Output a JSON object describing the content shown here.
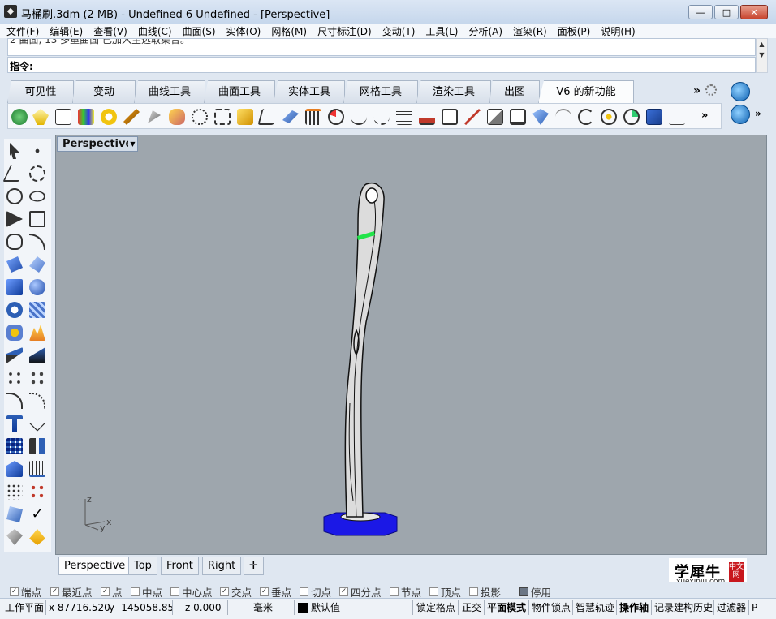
{
  "window": {
    "title": "马桶刷.3dm (2 MB) - Undefined 6 Undefined - [Perspective]",
    "min_label": "—",
    "max_label": "□",
    "close_label": "✕"
  },
  "menu": [
    "文件(F)",
    "编辑(E)",
    "查看(V)",
    "曲线(C)",
    "曲面(S)",
    "实体(O)",
    "网格(M)",
    "尺寸标注(D)",
    "变动(T)",
    "工具(L)",
    "分析(A)",
    "渲染(R)",
    "面板(P)",
    "说明(H)"
  ],
  "command": {
    "history": "2 曲面, 13 多重曲面 已加入至选取集合。",
    "prompt": "指令:"
  },
  "tabs": [
    "可见性",
    "变动",
    "曲线工具",
    "曲面工具",
    "实体工具",
    "网格工具",
    "渲染工具",
    "出图",
    "V6 的新功能"
  ],
  "active_tab": "V6 的新功能",
  "tab_more": "»",
  "toolbar_more": "»",
  "side_more": "»",
  "viewport": {
    "name": "Perspective",
    "dropdown": "▼",
    "axis_z": "z",
    "axis_y": "y",
    "axis_x": "x",
    "background_color": "#9ea6ad",
    "base_color": "#1b18e6",
    "highlight_color": "#22e44a"
  },
  "view_tabs": [
    "Perspective",
    "Top",
    "Front",
    "Right"
  ],
  "view_tab_add": "✛",
  "logo": {
    "text": "学犀牛",
    "sub": "xuexiniu.com",
    "badge": "中文网"
  },
  "osnap": [
    {
      "label": "端点",
      "checked": true
    },
    {
      "label": "最近点",
      "checked": true
    },
    {
      "label": "点",
      "checked": true
    },
    {
      "label": "中点",
      "checked": false
    },
    {
      "label": "中心点",
      "checked": false
    },
    {
      "label": "交点",
      "checked": true
    },
    {
      "label": "垂点",
      "checked": true
    },
    {
      "label": "切点",
      "checked": false
    },
    {
      "label": "四分点",
      "checked": true
    },
    {
      "label": "节点",
      "checked": false
    },
    {
      "label": "顶点",
      "checked": false
    },
    {
      "label": "投影",
      "checked": false
    }
  ],
  "osnap_disable": "停用",
  "status": {
    "cplane": "工作平面",
    "x": "x 87716.520",
    "y": "y -145058.85",
    "z": "z 0.000",
    "units": "毫米",
    "layer": "默认值",
    "grid_snap": "锁定格点",
    "ortho": "正交",
    "planar": "平面模式",
    "object_snap": "物件锁点",
    "smart_track": "智慧轨迹",
    "gumball": "操作轴",
    "history": "记录建构历史",
    "filter": "过滤器",
    "extra": "P"
  }
}
